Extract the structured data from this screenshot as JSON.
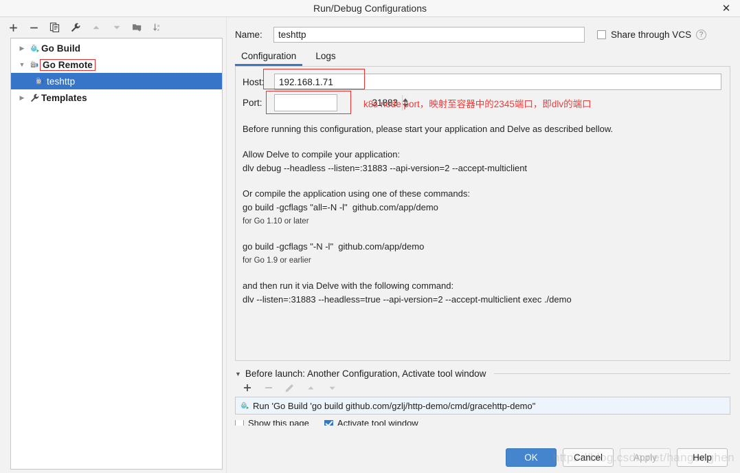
{
  "window": {
    "title": "Run/Debug Configurations",
    "close_icon": "close-icon"
  },
  "left_toolbar": {
    "buttons": [
      {
        "name": "add-configuration-button",
        "glyph": "+"
      },
      {
        "name": "remove-configuration-button",
        "glyph": "−"
      },
      {
        "name": "copy-configuration-button",
        "glyph": "❐"
      },
      {
        "name": "edit-templates-button",
        "glyph": "🔧"
      },
      {
        "name": "move-up-button",
        "glyph": "▲"
      },
      {
        "name": "move-down-button",
        "glyph": "▼"
      },
      {
        "name": "move-into-folder-button",
        "glyph": "🗀"
      },
      {
        "name": "sort-configurations-button",
        "glyph": "↓ᴀᶻ"
      }
    ]
  },
  "tree": {
    "items": [
      {
        "label": "Go Build",
        "twisty": "▶",
        "icon": "go-build-icon",
        "level": 0,
        "selected": false,
        "outlined": false
      },
      {
        "label": "Go Remote",
        "twisty": "▼",
        "icon": "go-remote-icon",
        "level": 0,
        "selected": false,
        "outlined": true
      },
      {
        "label": "teshttp",
        "twisty": "",
        "icon": "go-remote-icon",
        "level": 1,
        "selected": true,
        "outlined": false
      },
      {
        "label": "Templates",
        "twisty": "▶",
        "icon": "wrench-icon",
        "level": 0,
        "selected": false,
        "outlined": false
      }
    ]
  },
  "name_row": {
    "label": "Name:",
    "value": "teshttp",
    "placeholder": "",
    "share_label": "Share through VCS",
    "share_checked": false,
    "help_glyph": "?"
  },
  "tabs": [
    {
      "label": "Configuration",
      "active": true
    },
    {
      "label": "Logs",
      "active": false
    }
  ],
  "config": {
    "host_label": "Host:",
    "host_value": "192.168.1.71",
    "port_label": "Port:",
    "port_value": "31883",
    "annotation": "k8s node port，映射至容器中的2345端口，即dlv的端口",
    "annotation_color": "#f03a3a",
    "description": [
      {
        "text": "Before running this configuration, please start your application and Delve as described bellow.",
        "small": false
      },
      {
        "text": "",
        "small": false
      },
      {
        "text": "Allow Delve to compile your application:",
        "small": false
      },
      {
        "text": "dlv debug --headless --listen=:31883 --api-version=2 --accept-multiclient",
        "small": false
      },
      {
        "text": "",
        "small": false
      },
      {
        "text": "Or compile the application using one of these commands:",
        "small": false
      },
      {
        "text": "go build -gcflags \"all=-N -l\"  github.com/app/demo",
        "small": false
      },
      {
        "text": "for Go 1.10 or later",
        "small": true
      },
      {
        "text": "",
        "small": false
      },
      {
        "text": "go build -gcflags \"-N -l\"  github.com/app/demo",
        "small": false
      },
      {
        "text": "for Go 1.9 or earlier",
        "small": true
      },
      {
        "text": "",
        "small": false
      },
      {
        "text": "and then run it via Delve with the following command:",
        "small": false
      },
      {
        "text": "dlv --listen=:31883 --headless=true --api-version=2 --accept-multiclient exec ./demo",
        "small": false
      }
    ]
  },
  "before_launch": {
    "caret": "▼",
    "title": "Before launch: Another Configuration, Activate tool window",
    "toolbar": [
      {
        "name": "add-task-button",
        "glyph": "+"
      },
      {
        "name": "remove-task-button",
        "glyph": "−"
      },
      {
        "name": "edit-task-button",
        "glyph": "✎"
      },
      {
        "name": "move-task-up-button",
        "glyph": "▲"
      },
      {
        "name": "move-task-down-button",
        "glyph": "▼"
      }
    ],
    "items": [
      {
        "icon": "go-build-icon",
        "text": "Run 'Go Build 'go build github.com/gzlj/http-demo/cmd/gracehttp-demo\""
      }
    ],
    "checks": [
      {
        "label": "Show this page",
        "checked": false
      },
      {
        "label": "Activate tool window",
        "checked": true
      }
    ]
  },
  "footer": {
    "buttons": [
      {
        "label": "OK",
        "style": "primary",
        "name": "ok-button"
      },
      {
        "label": "Cancel",
        "style": "normal",
        "name": "cancel-button"
      },
      {
        "label": "Apply",
        "style": "disabled",
        "name": "apply-button"
      },
      {
        "label": "Help",
        "style": "normal",
        "name": "help-button"
      }
    ]
  },
  "watermark": "https://blog.csdn.net/hangonghen",
  "colors": {
    "selection_blue": "#3675c8",
    "tab_accent": "#3d77c2",
    "annotation_red": "#ef3131",
    "primary_button": "#4585cd"
  }
}
